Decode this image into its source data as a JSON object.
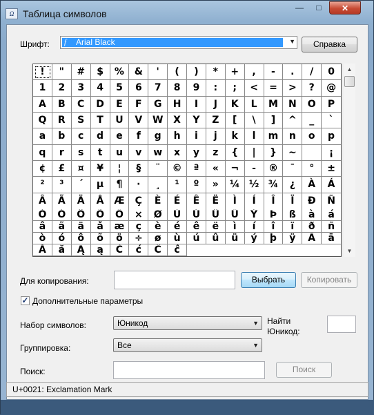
{
  "window": {
    "title": "Таблица символов",
    "icon": "charmap-icon",
    "controls": {
      "minimize": "—",
      "maximize": "□",
      "close": "✕"
    }
  },
  "font_row": {
    "label": "Шрифт:",
    "selected_font": "Arial Black",
    "help_button": "Справка"
  },
  "grid": {
    "selected_index": 0,
    "characters": [
      "!",
      "\"",
      "#",
      "$",
      "%",
      "&",
      "'",
      "(",
      ")",
      "*",
      "+",
      ",",
      "-",
      ".",
      "/",
      "0",
      "1",
      "2",
      "3",
      "4",
      "5",
      "6",
      "7",
      "8",
      "9",
      ":",
      ";",
      "<",
      "=",
      ">",
      "?",
      "@",
      "A",
      "B",
      "C",
      "D",
      "E",
      "F",
      "G",
      "H",
      "I",
      "J",
      "K",
      "L",
      "M",
      "N",
      "O",
      "P",
      "Q",
      "R",
      "S",
      "T",
      "U",
      "V",
      "W",
      "X",
      "Y",
      "Z",
      "[",
      "\\",
      "]",
      "^",
      "_",
      "`",
      "a",
      "b",
      "c",
      "d",
      "e",
      "f",
      "g",
      "h",
      "i",
      "j",
      "k",
      "l",
      "m",
      "n",
      "o",
      "p",
      "q",
      "r",
      "s",
      "t",
      "u",
      "v",
      "w",
      "x",
      "y",
      "z",
      "{",
      "|",
      "}",
      "~",
      " ",
      "¡",
      "¢",
      "£",
      "¤",
      "¥",
      "¦",
      "§",
      "¨",
      "©",
      "ª",
      "«",
      "¬",
      "-",
      "®",
      "¯",
      "°",
      "±",
      "²",
      "³",
      "´",
      "µ",
      "¶",
      "·",
      "¸",
      "¹",
      "º",
      "»",
      "¼",
      "½",
      "¾",
      "¿",
      "À",
      "Á",
      "Â",
      "Ã",
      "Ä",
      "Å",
      "Æ",
      "Ç",
      "È",
      "É",
      "Ê",
      "Ë",
      "Ì",
      "Í",
      "Î",
      "Ï",
      "Ð",
      "Ñ",
      "Ò",
      "Ó",
      "Ô",
      "Õ",
      "Ö",
      "×",
      "Ø",
      "Ù",
      "Ú",
      "Û",
      "Ü",
      "Ý",
      "Þ",
      "ß",
      "à",
      "á",
      "â",
      "ã",
      "ä",
      "å",
      "æ",
      "ç",
      "è",
      "é",
      "ê",
      "ë",
      "ì",
      "í",
      "î",
      "ï",
      "ð",
      "ñ",
      "ò",
      "ó",
      "ô",
      "õ",
      "ö",
      "÷",
      "ø",
      "ù",
      "ú",
      "û",
      "ü",
      "ý",
      "þ",
      "ÿ",
      "Ā",
      "ā",
      "Ă",
      "ă",
      "Ą",
      "ą",
      "Ć",
      "ć",
      "Ĉ",
      "ĉ"
    ]
  },
  "copy_row": {
    "label": "Для копирования:",
    "value": "",
    "select_button": "Выбрать",
    "copy_button": "Копировать"
  },
  "advanced": {
    "checkbox_label": "Дополнительные параметры",
    "checked": true,
    "charset_label": "Набор символов:",
    "charset_value": "Юникод",
    "grouping_label": "Группировка:",
    "grouping_value": "Все",
    "find_unicode_label_1": "Найти",
    "find_unicode_label_2": "Юникод:",
    "find_unicode_value": "",
    "search_label": "Поиск:",
    "search_value": "",
    "search_button": "Поиск"
  },
  "status": {
    "text": "U+0021: Exclamation Mark"
  }
}
